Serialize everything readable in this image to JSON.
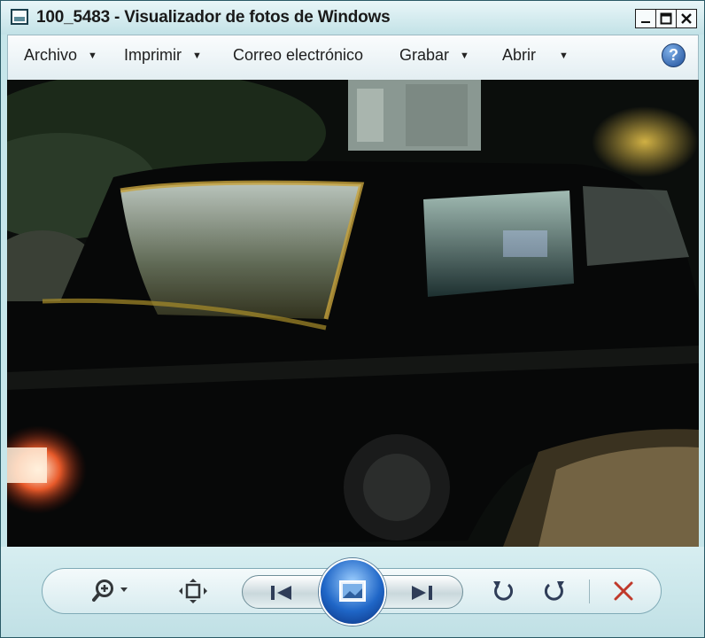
{
  "window": {
    "title": "100_5483 - Visualizador de fotos de Windows"
  },
  "menu": {
    "items": [
      {
        "label": "Archivo",
        "dropdown": true
      },
      {
        "label": "Imprimir",
        "dropdown": true
      },
      {
        "label": "Correo electrónico",
        "dropdown": false
      },
      {
        "label": "Grabar",
        "dropdown": true
      },
      {
        "label": "Abrir",
        "dropdown": true
      }
    ],
    "help_glyph": "?"
  },
  "photo": {
    "subject": "black car at night"
  },
  "toolbar": {
    "zoom_icon": "zoom-icon",
    "fit_icon": "actual-size-icon",
    "prev_icon": "previous-icon",
    "slideshow_icon": "slideshow-icon",
    "next_icon": "next-icon",
    "rotate_ccw_icon": "rotate-counterclockwise-icon",
    "rotate_cw_icon": "rotate-clockwise-icon",
    "delete_icon": "delete-icon"
  },
  "colors": {
    "chrome": "#c6e6ea",
    "accent": "#1f66c7",
    "delete": "#c0392b"
  }
}
